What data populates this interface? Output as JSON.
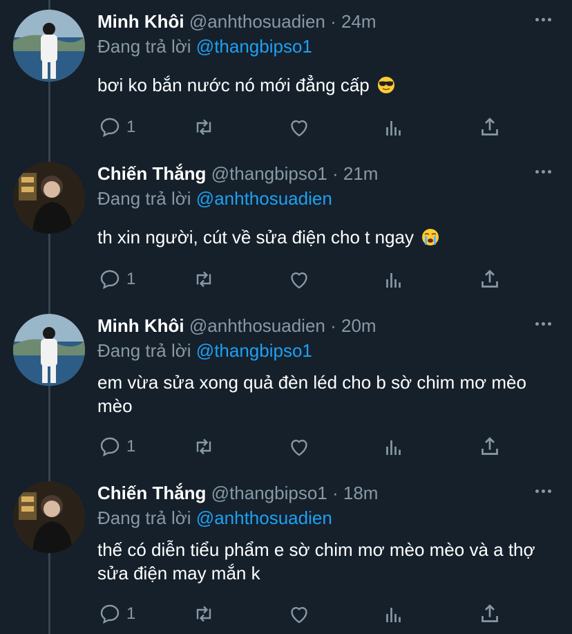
{
  "colors": {
    "background": "#15202b",
    "text": "#ffffff",
    "muted": "#8899a6",
    "accent": "#1da1f2",
    "thread_line": "#38444d"
  },
  "tweets": [
    {
      "name": "Minh Khôi",
      "handle": "@anhthosuadien",
      "dot": "·",
      "time": "24m",
      "replying_label": "Đang trả lời",
      "replying_to": "@thangbipso1",
      "text": "bơi ko bắn nước nó mới đẳng cấp",
      "emoji": "sunglasses-emoji",
      "reply_count": "1"
    },
    {
      "name": "Chiến Thắng",
      "handle": "@thangbipso1",
      "dot": "·",
      "time": "21m",
      "replying_label": "Đang trả lời",
      "replying_to": "@anhthosuadien",
      "text": "th xin người, cút về sửa điện cho t ngay",
      "emoji": "loudly-crying-emoji",
      "reply_count": "1"
    },
    {
      "name": "Minh Khôi",
      "handle": "@anhthosuadien",
      "dot": "·",
      "time": "20m",
      "replying_label": "Đang trả lời",
      "replying_to": "@thangbipso1",
      "text": "em vừa sửa xong quả đèn léd cho b sờ chim mơ mèo mèo",
      "emoji": "",
      "reply_count": "1"
    },
    {
      "name": "Chiến Thắng",
      "handle": "@thangbipso1",
      "dot": "·",
      "time": "18m",
      "replying_label": "Đang trả lời",
      "replying_to": "@anhthosuadien",
      "text": "thế có diễn tiểu phẩm e sờ chim mơ mèo mèo và a thợ sửa điện may mắn k",
      "emoji": "",
      "reply_count": "1"
    }
  ],
  "icons": {
    "reply": "reply-icon",
    "retweet": "retweet-icon",
    "like": "heart-icon",
    "analytics": "analytics-icon",
    "share": "share-icon",
    "more": "more-icon"
  }
}
